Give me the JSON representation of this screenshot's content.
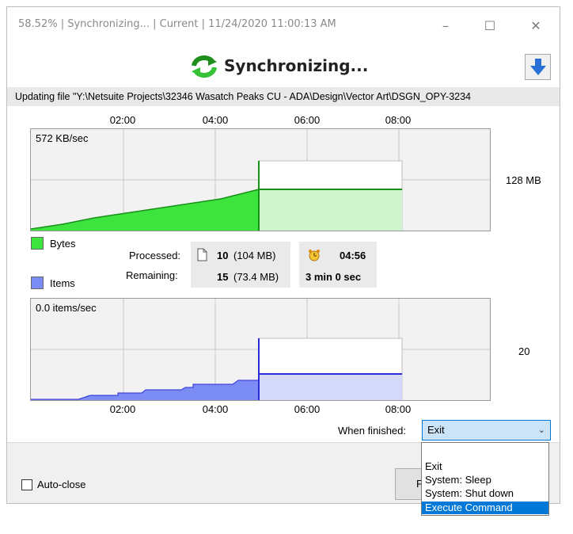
{
  "window": {
    "title": "58.52% | Synchronizing... | Current | 11/24/2020 11:00:13 AM",
    "controls": {
      "minimize": "–",
      "maximize": "☐",
      "close": "✕"
    }
  },
  "header": {
    "heading": "Synchronizing...",
    "progress_percent": 58.52,
    "colors": {
      "sync_icon": "#2bb02b",
      "collapse_arrow": "#2a6fd6"
    }
  },
  "status": {
    "file_line": "Updating file \"Y:\\Netsuite Projects\\32346 Wasatch Peaks CU - ADA\\Design\\Vector Art\\DSGN_OPY-3234"
  },
  "time_axis": {
    "ticks": [
      "02:00",
      "04:00",
      "06:00",
      "08:00"
    ]
  },
  "bytes_chart": {
    "rate_label": "572 KB/sec",
    "total_label": "128 MB",
    "legend": "Bytes",
    "colors": {
      "fill": "#3ee43e",
      "line": "#179017",
      "projected": "#cef5ce"
    }
  },
  "items_chart": {
    "rate_label": "0.0 items/sec",
    "total_label": "20",
    "legend": "Items",
    "colors": {
      "fill": "#7b8cf5",
      "line": "#2b2bd8",
      "projected": "#d4d8fb"
    }
  },
  "stats": {
    "processed_label": "Processed:",
    "processed_count": "10",
    "processed_size": "(104 MB)",
    "elapsed": "04:56",
    "remaining_label": "Remaining:",
    "remaining_count": "15",
    "remaining_size": "(73.4 MB)",
    "remaining_time": "3 min 0 sec"
  },
  "when_finished": {
    "label": "When finished:",
    "selected": "Exit",
    "options": [
      {
        "label": "Exit",
        "highlighted": false
      },
      {
        "label": "System: Sleep",
        "highlighted": false
      },
      {
        "label": "System: Shut down",
        "highlighted": false
      },
      {
        "label": "Execute Command",
        "highlighted": true
      }
    ]
  },
  "footer": {
    "auto_close_label": "Auto-close",
    "auto_close_checked": false,
    "pause_label": "P"
  }
}
